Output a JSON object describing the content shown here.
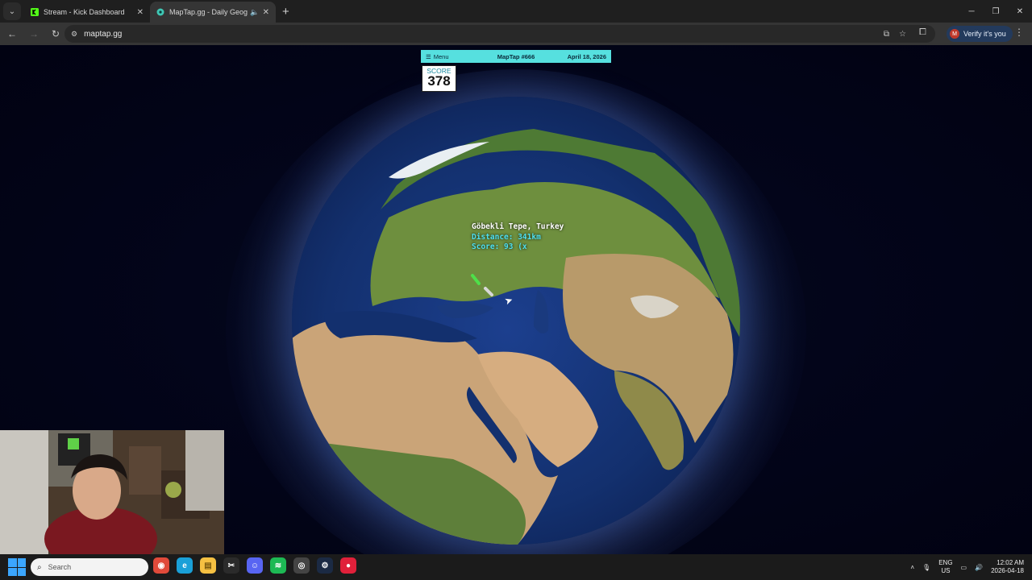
{
  "browser": {
    "tabs": [
      {
        "title": "Stream - Kick Dashboard",
        "active": false,
        "favicon_color": "#53fc18"
      },
      {
        "title": "MapTap.gg - Daily Geograp",
        "active": true,
        "favicon_color": "#3fc7b4"
      }
    ],
    "url": "maptap.gg",
    "verify_label": "Verify it's you",
    "verify_avatar": "M"
  },
  "game": {
    "menu_label": "Menu",
    "puzzle": "MapTap #666",
    "date": "April 18, 2026",
    "score_label": "SCORE",
    "score_value": "378",
    "result": {
      "place": "Göbekli Tepe, Turkey",
      "distance": "Distance: 341km",
      "score": "Score: 93 (x"
    }
  },
  "taskbar": {
    "search_placeholder": "Search",
    "lang_top": "ENG",
    "lang_bottom": "US",
    "time": "12:02 AM",
    "date": "2026-04-18",
    "apps": [
      {
        "name": "chrome-icon",
        "color": "#e04a3a"
      },
      {
        "name": "edge-icon",
        "color": "#1aa0d8"
      },
      {
        "name": "file-explorer-icon",
        "color": "#f5c042"
      },
      {
        "name": "capcut-icon",
        "color": "#2b2b2b"
      },
      {
        "name": "discord-icon",
        "color": "#5865f2"
      },
      {
        "name": "spotify-icon",
        "color": "#1db954"
      },
      {
        "name": "obs-icon",
        "color": "#444444"
      },
      {
        "name": "steam-icon",
        "color": "#1b2a44"
      },
      {
        "name": "record-app-icon",
        "color": "#e0203a"
      }
    ]
  }
}
